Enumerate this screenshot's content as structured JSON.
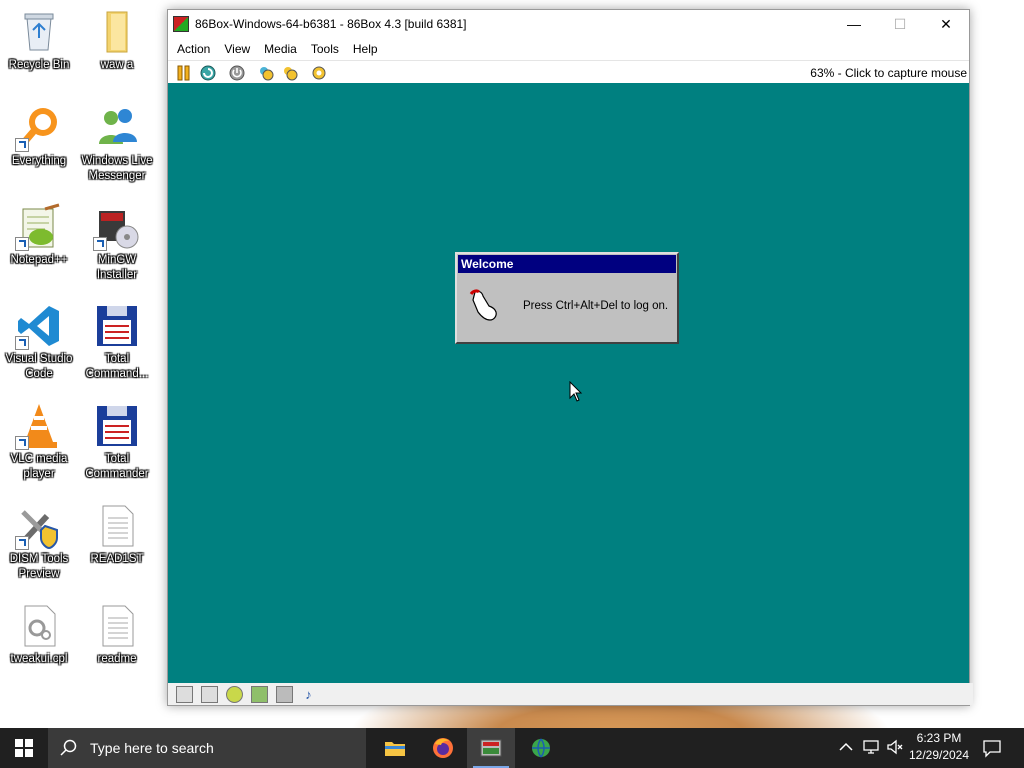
{
  "desktop": {
    "icons": [
      {
        "label": "Recycle Bin"
      },
      {
        "label": "waw a"
      },
      {
        "label": "Everything"
      },
      {
        "label": "Windows Live Messenger"
      },
      {
        "label": "Notepad++"
      },
      {
        "label": "MinGW Installer"
      },
      {
        "label": "Visual Studio Code"
      },
      {
        "label": "Total Command..."
      },
      {
        "label": "VLC media player"
      },
      {
        "label": "Total Commander"
      },
      {
        "label": "DISM Tools Preview"
      },
      {
        "label": "READ1ST"
      },
      {
        "label": "tweakui.cpl"
      },
      {
        "label": "readme"
      }
    ]
  },
  "window": {
    "title": "86Box-Windows-64-b6381 - 86Box 4.3 [build 6381]",
    "menu": [
      "Action",
      "View",
      "Media",
      "Tools",
      "Help"
    ],
    "status_text": "63% - Click to capture mouse",
    "controls": {
      "minimize": "—",
      "maximize": "☐",
      "close": "✕"
    }
  },
  "guest": {
    "background_color": "#008080",
    "dialog": {
      "title": "Welcome",
      "message": "Press Ctrl+Alt+Del to log on."
    }
  },
  "taskbar": {
    "search_placeholder": "Type here to search",
    "time": "6:23 PM",
    "date": "12/29/2024"
  }
}
